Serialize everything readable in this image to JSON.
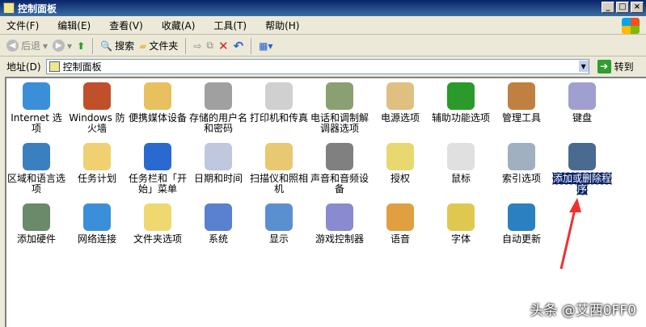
{
  "window": {
    "title": "控制面板"
  },
  "menu": [
    "文件(F)",
    "编辑(E)",
    "查看(V)",
    "收藏(A)",
    "工具(T)",
    "帮助(H)"
  ],
  "toolbar": {
    "back": "后退",
    "search": "搜索",
    "folders": "文件夹"
  },
  "address": {
    "label": "地址(D)",
    "value": "控制面板",
    "go": "转到"
  },
  "items": [
    {
      "label": "Internet 选项",
      "color": "#3a8fd8"
    },
    {
      "label": "Windows 防火墙",
      "color": "#c0502a"
    },
    {
      "label": "便携媒体设备",
      "color": "#e8c060"
    },
    {
      "label": "存储的用户名和密码",
      "color": "#a0a0a0"
    },
    {
      "label": "打印机和传真",
      "color": "#d0d0d0"
    },
    {
      "label": "电话和调制解调器选项",
      "color": "#8aa070"
    },
    {
      "label": "电源选项",
      "color": "#e0c080"
    },
    {
      "label": "辅助功能选项",
      "color": "#2a9a2a"
    },
    {
      "label": "管理工具",
      "color": "#c08040"
    },
    {
      "label": "键盘",
      "color": "#a0a0d0"
    },
    {
      "label": "区域和语言选项",
      "color": "#3a80c0"
    },
    {
      "label": "任务计划",
      "color": "#f0d070"
    },
    {
      "label": "任务栏和「开始」菜单",
      "color": "#2a6ad0"
    },
    {
      "label": "日期和时间",
      "color": "#c0c8e0"
    },
    {
      "label": "扫描仪和照相机",
      "color": "#e8c870"
    },
    {
      "label": "声音和音频设备",
      "color": "#808080"
    },
    {
      "label": "授权",
      "color": "#e8d870"
    },
    {
      "label": "鼠标",
      "color": "#e0e0e0"
    },
    {
      "label": "索引选项",
      "color": "#a0b0c0"
    },
    {
      "label": "添加或删除程序",
      "color": "#4a6a90",
      "selected": true
    },
    {
      "label": "添加硬件",
      "color": "#6a8a6a"
    },
    {
      "label": "网络连接",
      "color": "#3a8fd8"
    },
    {
      "label": "文件夹选项",
      "color": "#f0d870"
    },
    {
      "label": "系统",
      "color": "#5a80d0"
    },
    {
      "label": "显示",
      "color": "#5a90d0"
    },
    {
      "label": "游戏控制器",
      "color": "#8a8ad0"
    },
    {
      "label": "语音",
      "color": "#e0a040"
    },
    {
      "label": "字体",
      "color": "#e0c850"
    },
    {
      "label": "自动更新",
      "color": "#2a80c0"
    }
  ],
  "watermark": "头条 @艾西0FF0"
}
